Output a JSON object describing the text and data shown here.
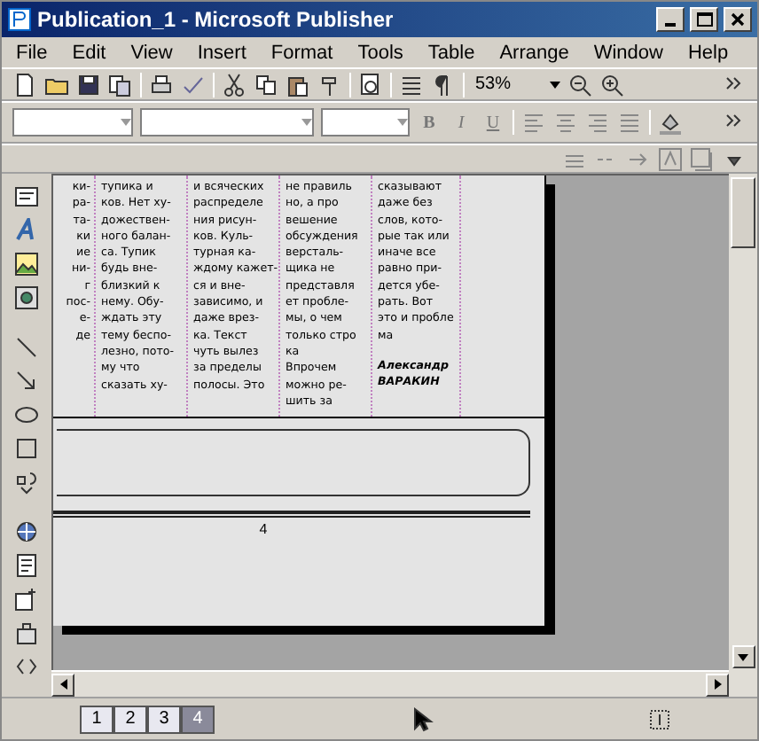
{
  "window": {
    "title": "Publication_1 - Microsoft Publisher"
  },
  "menu": [
    "File",
    "Edit",
    "View",
    "Insert",
    "Format",
    "Tools",
    "Table",
    "Arrange",
    "Window",
    "Help"
  ],
  "zoom": {
    "value": "53%"
  },
  "format_buttons": [
    "B",
    "I",
    "U"
  ],
  "columns": [
    {
      "lines": [
        "ки-",
        "ра-",
        "та-",
        "ки",
        "ие",
        "ни-",
        "г",
        "пос-",
        "е-",
        "де"
      ]
    },
    {
      "lines": [
        "тупика и",
        "ков. Нет ху-",
        "дожествен-",
        "ного балан-",
        "са. Тупик",
        "будь вне-",
        "близкий к",
        "нему. Обу-",
        "ждать эту",
        "тему беспо-",
        "лезно, пото-",
        "му что",
        "сказать ху-"
      ]
    },
    {
      "lines": [
        "и всяческих",
        "распределе",
        "ния рисун-",
        "ков. Куль-",
        "турная ка-",
        "ждому кажет-",
        "ся и вне-",
        "зависимо, и",
        "даже врез-",
        "ка. Текст",
        "чуть вылез",
        "за пределы",
        "полосы. Это"
      ]
    },
    {
      "lines": [
        "не правиль",
        "но, а про",
        "вешение",
        "обсуждения",
        "версталь-",
        "щика не",
        "представля",
        "ет пробле-",
        "мы, о чем",
        "только стро",
        "ка",
        "Впрочем",
        "можно ре-",
        "шить за"
      ]
    },
    {
      "lines": [
        "сказывают",
        "даже без",
        "слов, кото-",
        "рые так или",
        "иначе все",
        "равно при-",
        "дется убе-",
        "рать. Вот",
        "это и пробле",
        "ма"
      ],
      "signature": [
        "Александр",
        "ВАРАКИН"
      ]
    }
  ],
  "page_number": "4",
  "pages": [
    {
      "label": "1",
      "selected": false
    },
    {
      "label": "2",
      "selected": false
    },
    {
      "label": "3",
      "selected": false
    },
    {
      "label": "4",
      "selected": true
    }
  ]
}
